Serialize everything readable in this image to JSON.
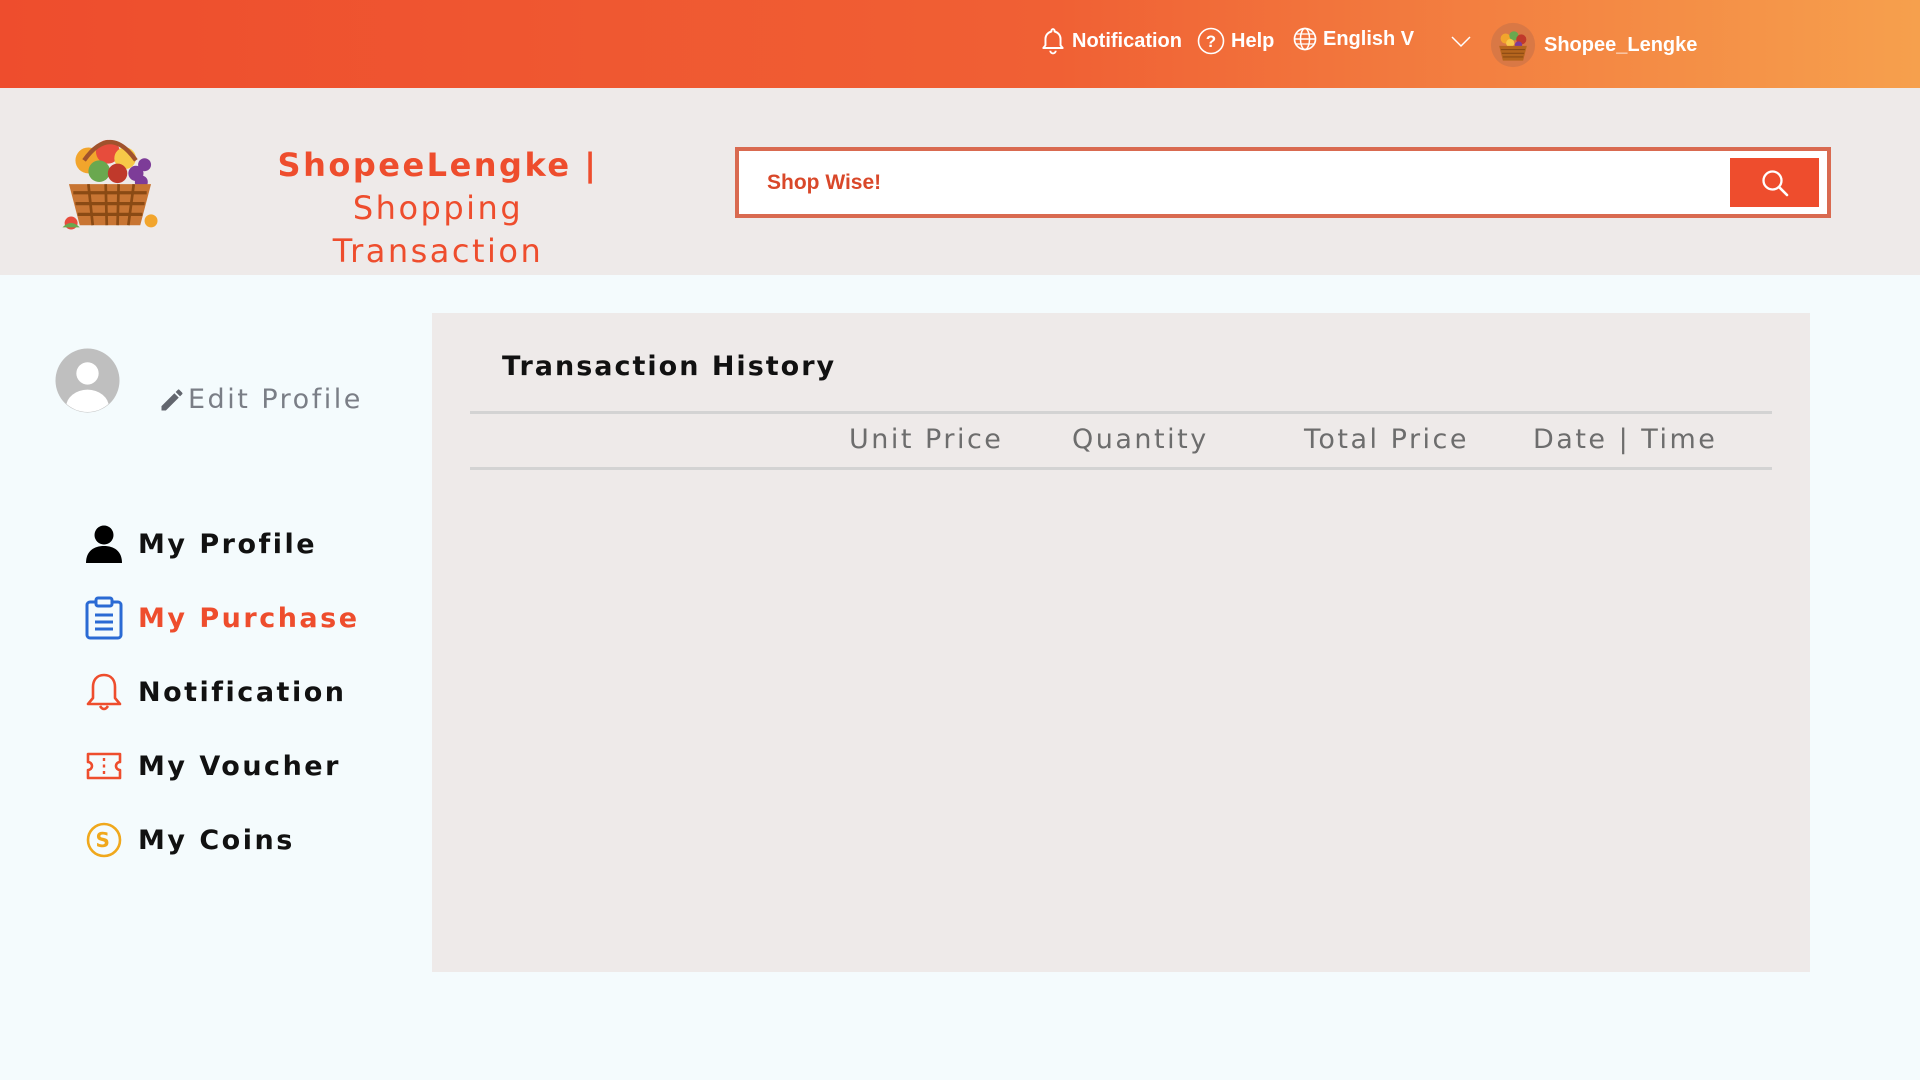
{
  "topbar": {
    "notification_label": "Notification",
    "help_label": "Help",
    "language_label": "English V",
    "username": "Shopee_Lengke"
  },
  "header": {
    "brand_name": "ShopeeLengke",
    "separator": "|",
    "page_title_line1": "Shopping",
    "page_title_line2": "Transaction",
    "search_placeholder": "Shop Wise!"
  },
  "sidebar": {
    "edit_profile_label": "Edit Profile",
    "items": [
      {
        "label": "My Profile",
        "icon": "user-icon"
      },
      {
        "label": "My Purchase",
        "icon": "clipboard-icon",
        "active": true
      },
      {
        "label": "Notification",
        "icon": "bell-icon"
      },
      {
        "label": "My Voucher",
        "icon": "ticket-icon"
      },
      {
        "label": "My Coins",
        "icon": "coin-icon"
      }
    ]
  },
  "main": {
    "title": "Transaction History",
    "columns": [
      "Unit Price",
      "Quantity",
      "Total Price",
      "Date | Time"
    ],
    "rows": []
  },
  "colors": {
    "accent": "#ee4d2d",
    "gradient_end": "#f6a04d",
    "header_bg": "#eeeae9",
    "page_bg": "#f4fbfd"
  }
}
